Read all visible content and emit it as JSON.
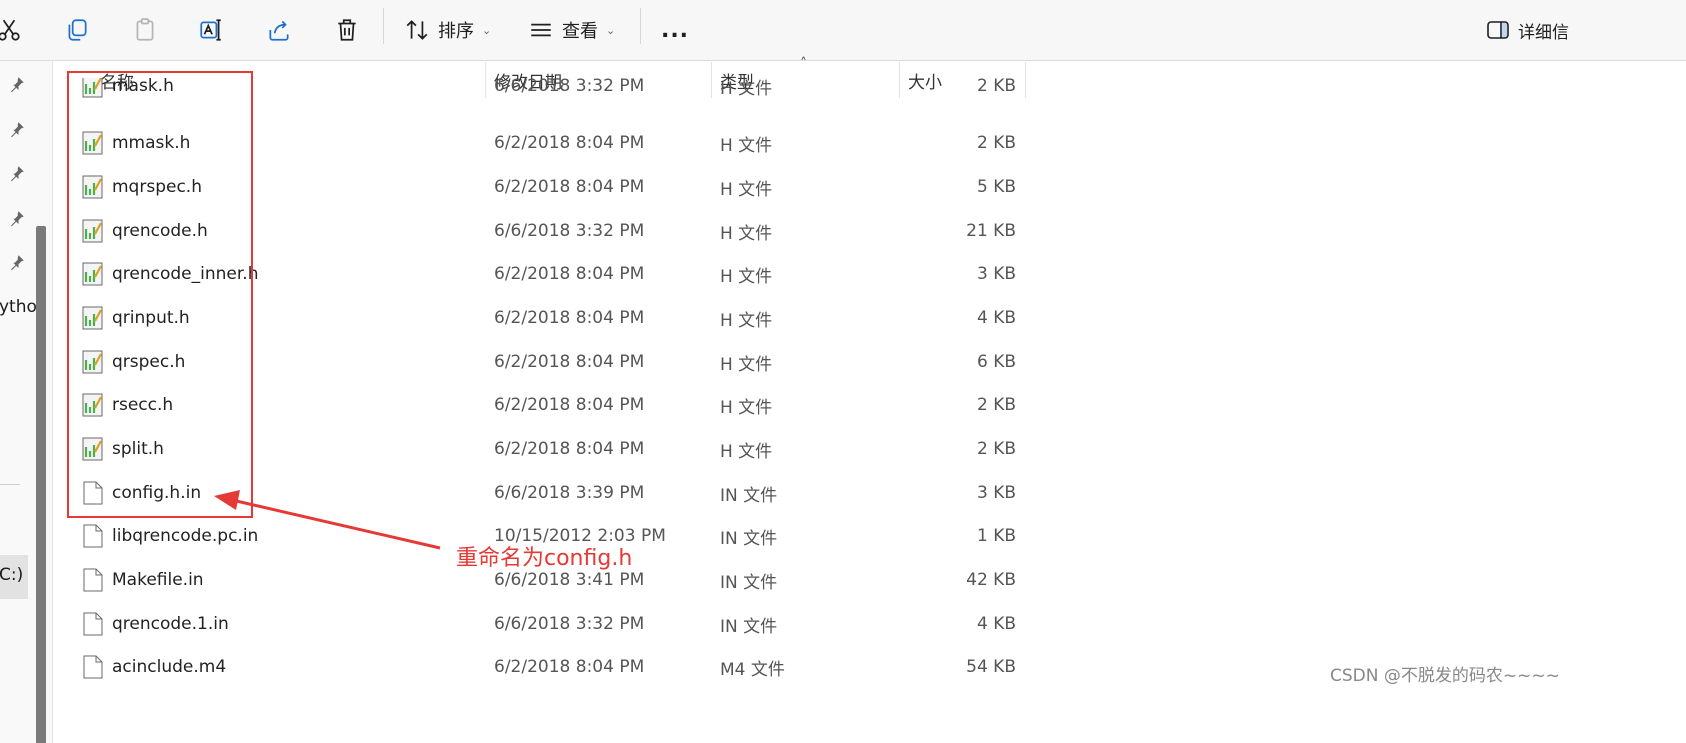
{
  "toolbar": {
    "sort_label": "排序",
    "view_label": "查看",
    "more_label": "...",
    "details_label": "详细信"
  },
  "nav": {
    "fragment_python": "ytho",
    "fragment_drive": "C:)"
  },
  "columns": {
    "name": "名称",
    "date": "修改日期",
    "type": "类型",
    "size": "大小"
  },
  "files": [
    {
      "name": "mask.h",
      "date": "6/6/2018 3:32 PM",
      "type": "H 文件",
      "size": "2 KB",
      "icon": "header-file-icon"
    },
    {
      "name": "mmask.h",
      "date": "6/2/2018 8:04 PM",
      "type": "H 文件",
      "size": "2 KB",
      "icon": "header-file-icon"
    },
    {
      "name": "mqrspec.h",
      "date": "6/2/2018 8:04 PM",
      "type": "H 文件",
      "size": "5 KB",
      "icon": "header-file-icon"
    },
    {
      "name": "qrencode.h",
      "date": "6/6/2018 3:32 PM",
      "type": "H 文件",
      "size": "21 KB",
      "icon": "header-file-icon"
    },
    {
      "name": "qrencode_inner.h",
      "date": "6/2/2018 8:04 PM",
      "type": "H 文件",
      "size": "3 KB",
      "icon": "header-file-icon"
    },
    {
      "name": "qrinput.h",
      "date": "6/2/2018 8:04 PM",
      "type": "H 文件",
      "size": "4 KB",
      "icon": "header-file-icon"
    },
    {
      "name": "qrspec.h",
      "date": "6/2/2018 8:04 PM",
      "type": "H 文件",
      "size": "6 KB",
      "icon": "header-file-icon"
    },
    {
      "name": "rsecc.h",
      "date": "6/2/2018 8:04 PM",
      "type": "H 文件",
      "size": "2 KB",
      "icon": "header-file-icon"
    },
    {
      "name": "split.h",
      "date": "6/2/2018 8:04 PM",
      "type": "H 文件",
      "size": "2 KB",
      "icon": "header-file-icon"
    },
    {
      "name": "config.h.in",
      "date": "6/6/2018 3:39 PM",
      "type": "IN 文件",
      "size": "3 KB",
      "icon": "blank-file-icon"
    },
    {
      "name": "libqrencode.pc.in",
      "date": "10/15/2012 2:03 PM",
      "type": "IN 文件",
      "size": "1 KB",
      "icon": "blank-file-icon"
    },
    {
      "name": "Makefile.in",
      "date": "6/6/2018 3:41 PM",
      "type": "IN 文件",
      "size": "42 KB",
      "icon": "blank-file-icon"
    },
    {
      "name": "qrencode.1.in",
      "date": "6/6/2018 3:32 PM",
      "type": "IN 文件",
      "size": "4 KB",
      "icon": "blank-file-icon"
    },
    {
      "name": "acinclude.m4",
      "date": "6/2/2018 8:04 PM",
      "type": "M4 文件",
      "size": "54 KB",
      "icon": "blank-file-icon"
    }
  ],
  "annotation": {
    "text": "重命名为config.h",
    "color": "#e53935"
  },
  "watermark": "CSDN @不脱发的码农~~~~"
}
